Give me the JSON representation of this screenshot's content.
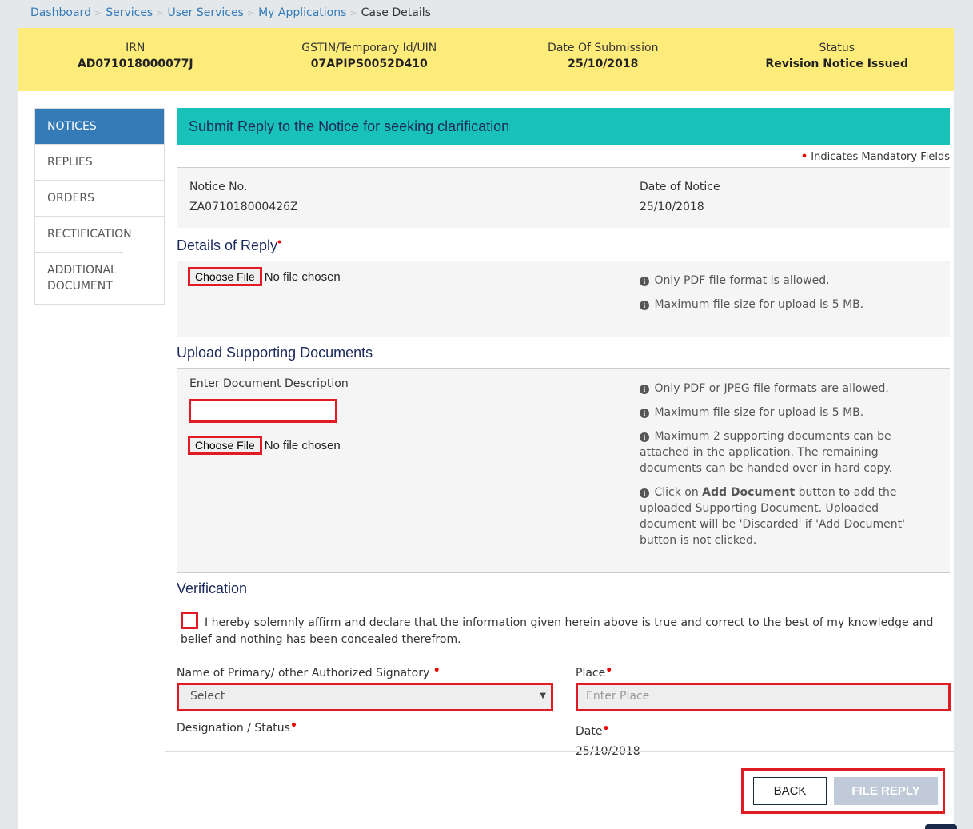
{
  "breadcrumb": [
    {
      "label": "Dashboard"
    },
    {
      "label": "Services"
    },
    {
      "label": "User Services"
    },
    {
      "label": "My Applications"
    }
  ],
  "breadcrumb_current": "Case Details",
  "banner": {
    "irn_label": "IRN",
    "irn_value": "AD071018000077J",
    "gstin_label": "GSTIN/Temporary Id/UIN",
    "gstin_value": "07APIPS0052D410",
    "date_label": "Date Of Submission",
    "date_value": "25/10/2018",
    "status_label": "Status",
    "status_value": "Revision Notice Issued"
  },
  "sidenav": {
    "items": [
      {
        "label": "NOTICES",
        "active": true
      },
      {
        "label": "REPLIES"
      },
      {
        "label": "ORDERS"
      },
      {
        "label": "RECTIFICATION"
      },
      {
        "label": "ADDITIONAL DOCUMENT"
      }
    ]
  },
  "main": {
    "title": "Submit Reply to the Notice for seeking clarification",
    "mandatory_note": "Indicates Mandatory Fields",
    "notice_no_label": "Notice No.",
    "notice_no_value": "ZA071018000426Z",
    "notice_date_label": "Date of Notice",
    "notice_date_value": "25/10/2018",
    "details_title": "Details of Reply",
    "choose_file_label": "Choose File",
    "no_file_text": "No file chosen",
    "details_info": [
      "Only PDF file format is allowed.",
      "Maximum file size for upload is 5 MB."
    ],
    "upload_title": "Upload Supporting Documents",
    "desc_label": "Enter Document Description",
    "desc_value": "",
    "upload_info": [
      "Only PDF or JPEG file formats are allowed.",
      "Maximum file size for upload is 5 MB.",
      "Maximum 2 supporting documents can be attached in the application. The remaining documents can be handed over in hard copy."
    ],
    "upload_info_last_pre": "Click on ",
    "upload_info_last_bold": "Add Document",
    "upload_info_last_post": " button to add the uploaded Supporting Document. Uploaded document will be 'Discarded' if 'Add Document' button is not clicked.",
    "verification_title": "Verification",
    "declaration": "I hereby solemnly affirm and declare that the information given herein above is true and correct to the best of my knowledge and belief and nothing has been concealed therefrom.",
    "signatory_label": "Name of Primary/ other Authorized Signatory",
    "signatory_selected": "Select",
    "place_label": "Place",
    "place_placeholder": "Enter Place",
    "designation_label": "Designation / Status",
    "date_label": "Date",
    "date_value": "25/10/2018",
    "back_label": "BACK",
    "file_reply_label": "FILE REPLY"
  },
  "colors": {
    "banner": "#fdeb7a",
    "title_bar": "#19c2b9",
    "active_nav": "#337ab7",
    "highlight": "#e01b24",
    "disabled_button": "#c0cad8"
  }
}
